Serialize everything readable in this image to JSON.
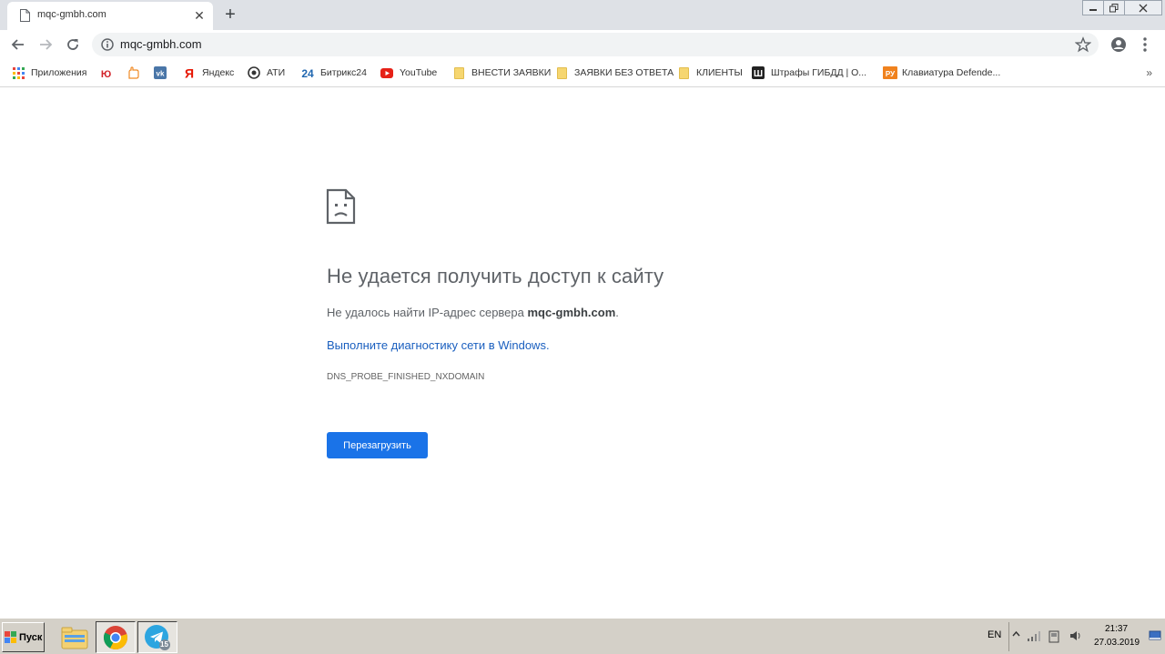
{
  "tab": {
    "title": "mqc-gmbh.com",
    "close_glyph": "✕",
    "new_tab_glyph": "+"
  },
  "toolbar": {
    "url": "mqc-gmbh.com"
  },
  "bookmarks": [
    {
      "label": "Приложения",
      "icon": "apps-grid-icon"
    },
    {
      "label": "",
      "icon": "yu-icon"
    },
    {
      "label": "",
      "icon": "hand-icon"
    },
    {
      "label": "",
      "icon": "vk-icon"
    },
    {
      "label": "Яндекс",
      "icon": "yandex-icon"
    },
    {
      "label": "АТИ",
      "icon": "ati-icon"
    },
    {
      "label": "Битрикс24",
      "icon": "bitrix24-icon"
    },
    {
      "label": "YouTube",
      "icon": "youtube-icon"
    },
    {
      "label": "ВНЕСТИ ЗАЯВКИ",
      "icon": "folder-icon"
    },
    {
      "label": "ЗАЯВКИ БЕЗ ОТВЕТА",
      "icon": "folder-icon"
    },
    {
      "label": "КЛИЕНТЫ",
      "icon": "folder-icon"
    },
    {
      "label": "Штрафы ГИБДД | О...",
      "icon": "shtrafy-icon"
    },
    {
      "label": "Клавиатура Defende...",
      "icon": "ru-icon"
    }
  ],
  "bookmarks_overflow": "»",
  "error": {
    "title": "Не удается получить доступ к сайту",
    "desc_prefix": "Не удалось найти IP-адрес сервера ",
    "desc_host": "mqc-gmbh.com",
    "desc_suffix": ".",
    "link": "Выполните диагностику сети в Windows.",
    "code": "DNS_PROBE_FINISHED_NXDOMAIN",
    "reload_button": "Перезагрузить"
  },
  "taskbar": {
    "start_label": "Пуск",
    "telegram_badge": "15",
    "language": "EN",
    "time": "21:37",
    "date": "27.03.2019"
  },
  "colors": {
    "accent": "#1a73e8",
    "link": "#1a5fbf",
    "tabstrip": "#dee1e6",
    "taskbar": "#d4d0c8"
  }
}
